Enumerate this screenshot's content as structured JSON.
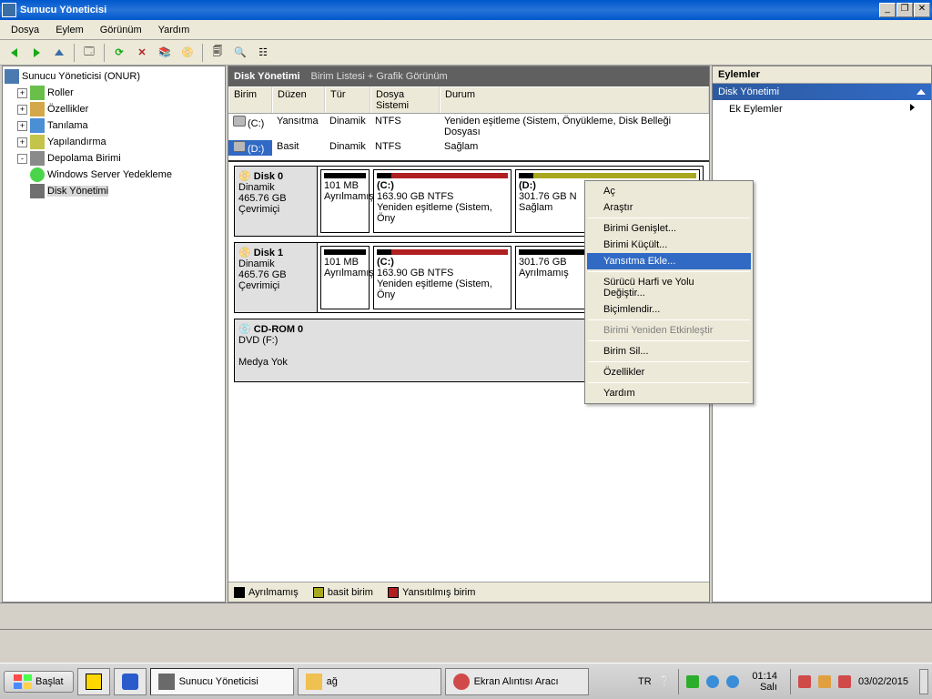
{
  "window": {
    "title": "Sunucu Yöneticisi"
  },
  "menu": {
    "dosya": "Dosya",
    "eylem": "Eylem",
    "gorunum": "Görünüm",
    "yardim": "Yardım"
  },
  "tree": {
    "root": "Sunucu Yöneticisi (ONUR)",
    "roller": "Roller",
    "ozellikler": "Özellikler",
    "tanilama": "Tanılama",
    "yapilandirma": "Yapılandırma",
    "depolama": "Depolama Birimi",
    "backup": "Windows Server Yedekleme",
    "diskmgmt": "Disk Yönetimi"
  },
  "center": {
    "title": "Disk Yönetimi",
    "subtitle": "Birim Listesi + Grafik Görünüm",
    "cols": {
      "birim": "Birim",
      "duzen": "Düzen",
      "tur": "Tür",
      "ds": "Dosya Sistemi",
      "durum": "Durum"
    },
    "rows": [
      {
        "birim": "(C:)",
        "duzen": "Yansıtma",
        "tur": "Dinamik",
        "ds": "NTFS",
        "durum": "Yeniden eşitleme (Sistem, Önyükleme, Disk Belleği Dosyası"
      },
      {
        "birim": "(D:)",
        "duzen": "Basit",
        "tur": "Dinamik",
        "ds": "NTFS",
        "durum": "Sağlam"
      }
    ]
  },
  "disks": {
    "d0": {
      "name": "Disk 0",
      "type": "Dinamik",
      "size": "465.76 GB",
      "status": "Çevrimiçi",
      "p0": {
        "name": "",
        "size": "101 MB",
        "info": "Ayrılmamış"
      },
      "p1": {
        "name": "(C:)",
        "size": "163.90 GB NTFS",
        "info": "Yeniden eşitleme (Sistem, Öny"
      },
      "p2": {
        "name": "(D:)",
        "size": "301.76 GB N",
        "info": "Sağlam"
      }
    },
    "d1": {
      "name": "Disk 1",
      "type": "Dinamik",
      "size": "465.76 GB",
      "status": "Çevrimiçi",
      "p0": {
        "name": "",
        "size": "101 MB",
        "info": "Ayrılmamış"
      },
      "p1": {
        "name": "(C:)",
        "size": "163.90 GB NTFS",
        "info": "Yeniden eşitleme (Sistem, Öny"
      },
      "p2": {
        "name": "",
        "size": "301.76 GB",
        "info": "Ayrılmamış"
      }
    },
    "cd": {
      "name": "CD-ROM 0",
      "type": "DVD (F:)",
      "status": "Medya Yok"
    }
  },
  "legend": {
    "ayrilmamis": "Ayrılmamış",
    "basit": "basit birim",
    "yansitilmis": "Yansıtılmış birim"
  },
  "actions": {
    "title": "Eylemler",
    "disk": "Disk Yönetimi",
    "ek": "Ek Eylemler"
  },
  "ctx": {
    "ac": "Aç",
    "arastir": "Araştır",
    "genislet": "Birimi Genişlet...",
    "kucult": "Birimi Küçült...",
    "yansitma": "Yansıtma Ekle...",
    "harf": "Sürücü Harfi ve Yolu Değiştir...",
    "bicimlendir": "Biçimlendir...",
    "etkinlestir": "Birimi Yeniden Etkinleştir",
    "sil": "Birim Sil...",
    "ozellikler": "Özellikler",
    "yardim": "Yardım"
  },
  "taskbar": {
    "start": "Başlat",
    "srv": "Sunucu Yöneticisi",
    "ag": "ağ",
    "snip": "Ekran Alıntısı Aracı",
    "lang": "TR",
    "time": "01:14",
    "day": "Salı",
    "date": "03/02/2015"
  }
}
